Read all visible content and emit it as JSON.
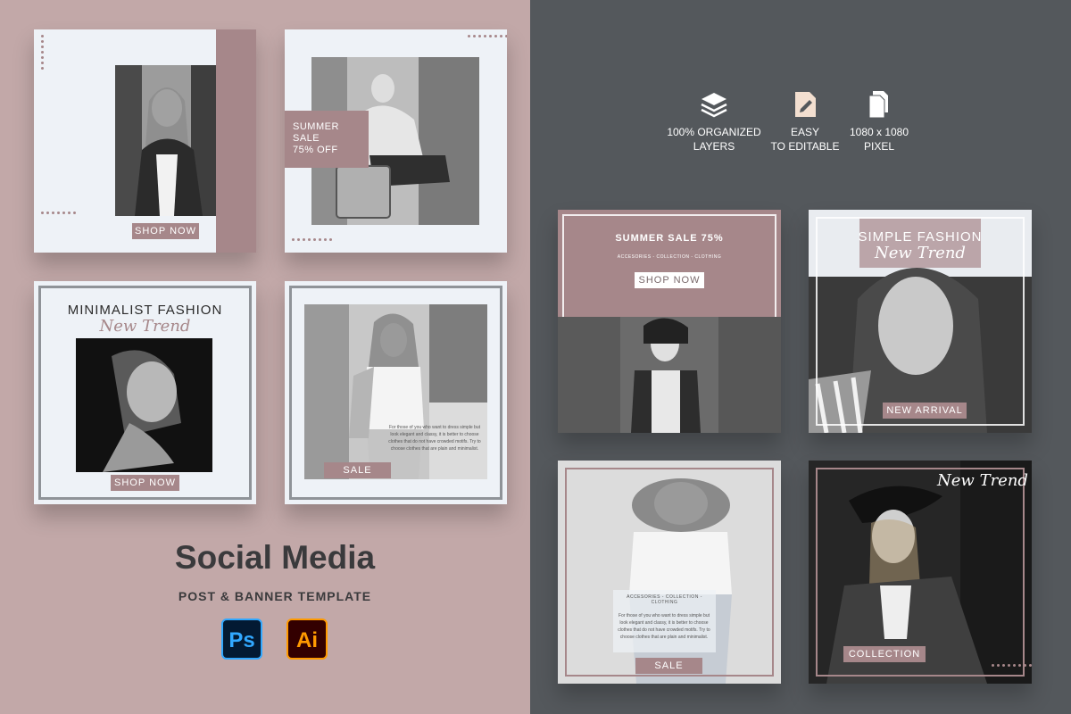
{
  "header": {
    "title": "Social Media",
    "subtitle": "POST & BANNER TEMPLATE"
  },
  "apps": [
    {
      "label": "Ps",
      "icon": "photoshop-icon",
      "bg": "#031a33",
      "fg": "#31a8ff"
    },
    {
      "label": "Ai",
      "icon": "illustrator-icon",
      "bg": "#330000",
      "fg": "#ff9a00"
    }
  ],
  "features": [
    {
      "icon": "layers-icon",
      "line1": "100% ORGANIZED",
      "line2": "LAYERS"
    },
    {
      "icon": "edit-file-icon",
      "line1": "EASY",
      "line2": "TO EDITABLE"
    },
    {
      "icon": "document-icon",
      "line1": "1080 x 1080",
      "line2": "PIXEL"
    }
  ],
  "templates": {
    "t1": {
      "button": "SHOP NOW"
    },
    "t2": {
      "line1": "SUMMER",
      "line2": "SALE",
      "line3": "75% OFF"
    },
    "t3": {
      "headline": "MINIMALIST FASHION",
      "script": "New Trend",
      "button": "SHOP NOW"
    },
    "t4": {
      "body": "For those of you who want to dress simple but look elegant and classy, it is better to choose clothes that do not have crowded motifs. Try to choose clothes that are plain and minimalist.",
      "button": "SALE"
    },
    "t5": {
      "headline": "SUMMER SALE 75%",
      "tagline": "ACCESORIES - COLLECTION - CLOTHING",
      "button": "SHOP NOW"
    },
    "t6": {
      "headline": "SIMPLE FASHION",
      "script": "New Trend",
      "button": "NEW ARRIVAL"
    },
    "t7": {
      "tagline": "ACCESORIES - COLLECTION - CLOTHING",
      "body": "For those of you who want to dress simple but look elegant and classy, it is better to choose clothes that do not have crowded motifs. Try to choose clothes that are plain and minimalist.",
      "button": "SALE"
    },
    "t8": {
      "script": "New Trend",
      "button": "COLLECTION"
    }
  },
  "colors": {
    "accent": "#a6878a",
    "left_bg": "#c2a8a8",
    "right_bg": "#54585c",
    "card": "#eef2f7"
  }
}
